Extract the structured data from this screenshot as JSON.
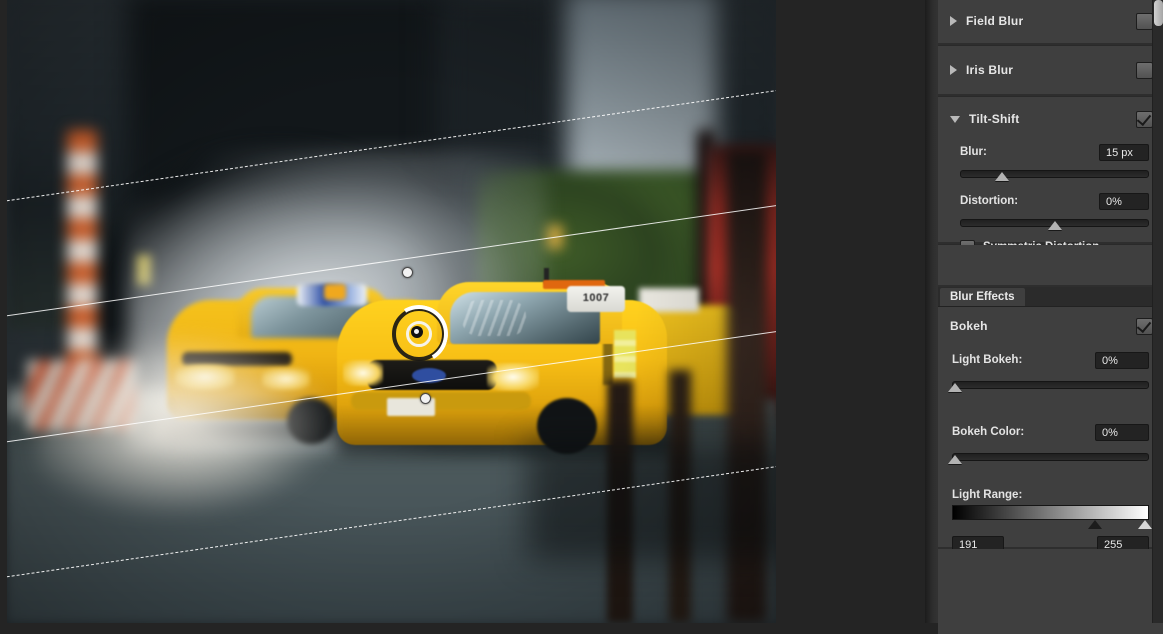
{
  "panels": {
    "field_blur": {
      "title": "Field Blur",
      "expanded": false,
      "enabled": false,
      "arrow_icon": "triangle-right-icon"
    },
    "iris_blur": {
      "title": "Iris Blur",
      "expanded": false,
      "enabled": false,
      "arrow_icon": "triangle-right-icon"
    },
    "tilt_shift": {
      "title": "Tilt-Shift",
      "expanded": true,
      "enabled": true,
      "arrow_icon": "triangle-down-icon",
      "blur": {
        "label": "Blur:",
        "value": "15 px",
        "slider_pct": 22
      },
      "distortion": {
        "label": "Distortion:",
        "value": "0%",
        "slider_pct": 50
      },
      "symmetric_distortion": {
        "label": "Symmetric Distortion",
        "checked": false
      }
    }
  },
  "blur_effects": {
    "tab_label": "Blur Effects",
    "bokeh": {
      "label": "Bokeh",
      "checked": true
    },
    "light_bokeh": {
      "label": "Light Bokeh:",
      "value": "0%",
      "slider_pct": 0
    },
    "bokeh_color": {
      "label": "Bokeh Color:",
      "value": "0%",
      "slider_pct": 0
    },
    "light_range": {
      "label": "Light Range:",
      "min_value": "191",
      "max_value": "255",
      "min_pct": 75,
      "max_pct": 100
    }
  },
  "canvas": {
    "photo_alt": "city-street-taxis-photo",
    "taxi_top_light_text": "1007",
    "overlay": {
      "top_dashed_label": "tilt-shift-top-feather-line",
      "top_solid_label": "tilt-shift-top-focus-line",
      "bottom_solid_label": "tilt-shift-bottom-focus-line",
      "bottom_dashed_label": "tilt-shift-bottom-feather-line",
      "center_pin_label": "tilt-shift-blur-ring"
    }
  },
  "colors": {
    "panel_bg": "#3f3f3f",
    "panel_gutter": "#2e2e2e",
    "canvas_bg": "#242424",
    "text": "#e6e6e6",
    "field_bg": "#232323",
    "knob": "#b3b3b3"
  }
}
